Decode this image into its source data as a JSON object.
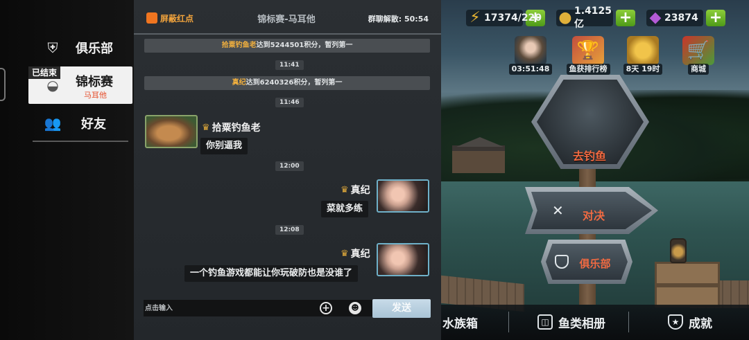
{
  "hud": {
    "energy": "17374/220",
    "coins": "1.4125亿",
    "gems": "23874",
    "plus": "+"
  },
  "quick_icons": [
    {
      "label": "03:51:48",
      "icon": "avatar-portrait"
    },
    {
      "label": "鱼获排行榜",
      "icon": "trophy-fish"
    },
    {
      "label": "8天 19时",
      "icon": "golden-fish"
    },
    {
      "label": "商城",
      "icon": "shopping-cart"
    }
  ],
  "signs": {
    "go_fishing": "去钓鱼",
    "duel": "对决",
    "club": "俱乐部"
  },
  "bottom_bar": {
    "aquarium": "水族箱",
    "fish_album": "鱼类相册",
    "achievements": "成就"
  },
  "left_nav": {
    "club": "俱乐部",
    "tournament": "锦标赛",
    "tournament_sub": "马耳他",
    "tournament_badge": "已结束",
    "friends": "好友"
  },
  "chat": {
    "mute_label": "屏蔽红点",
    "title": "锦标赛-马耳他",
    "timer_label": "群聊解散:",
    "timer_value": "50:54",
    "sys1_name": "拾粟钓鱼老",
    "sys1_text": "达到5244501积分，暂列第一",
    "time1": "11:41",
    "sys2_name": "真纪",
    "sys2_text": "达到6240326积分，暂列第一",
    "time2": "11:46",
    "msg1_user": "拾粟钓鱼老",
    "msg1_text": "你别逼我",
    "time3": "12:00",
    "msg2_user": "真纪",
    "msg2_text": "菜就多练",
    "time4": "12:08",
    "msg3_user": "真纪",
    "msg3_text": "一个钓鱼游戏都能让你玩破防也是没谁了",
    "input_placeholder": "点击输入",
    "send_label": "发送"
  },
  "colors": {
    "accent_orange": "#f06a42",
    "name_gold": "#f2b03e",
    "plus_green": "#6fb528",
    "send_blue": "#b3cbdc"
  }
}
